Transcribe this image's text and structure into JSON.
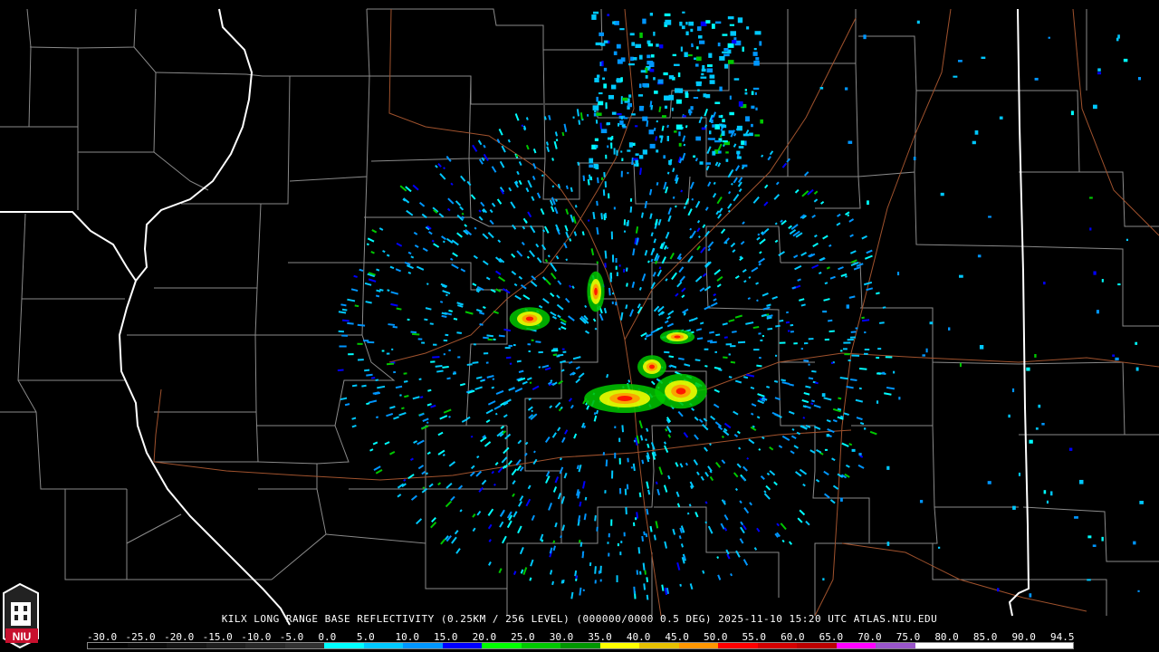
{
  "product": {
    "caption": "KILX LONG RANGE BASE REFLECTIVITY (0.25KM / 256 LEVEL) (000000/0000 0.5 DEG) 2025-11-10 15:20 UTC  ATLAS.NIU.EDU"
  },
  "logo": {
    "text": "NIU",
    "color": "#c8102e"
  },
  "colorbar": {
    "labels": [
      "-30.0",
      "-25.0",
      "-20.0",
      "-15.0",
      "-10.0",
      "-5.0",
      "0.0",
      "5.0",
      "10.0",
      "15.0",
      "20.0",
      "25.0",
      "30.0",
      "35.0",
      "40.0",
      "45.0",
      "50.0",
      "55.0",
      "60.0",
      "65.0",
      "70.0",
      "75.0",
      "80.0",
      "85.0",
      "90.0",
      "94.5"
    ],
    "colors": [
      "#000000",
      "#0a0a0a",
      "#141414",
      "#1e1e1e",
      "#282828",
      "#323232",
      "#00ffff",
      "#00c8ff",
      "#0096ff",
      "#0000ff",
      "#00ff00",
      "#00c800",
      "#009600",
      "#ffff00",
      "#e6c000",
      "#ff9600",
      "#ff0000",
      "#d40000",
      "#bc0000",
      "#ff00ff",
      "#9955c9",
      "#ffffff",
      "#ffffff",
      "#ffffff",
      "#ffffff"
    ]
  },
  "colors": {
    "state_border": "#ffffff",
    "county_border": "#8a8a8a",
    "highway": "#a0522d"
  }
}
